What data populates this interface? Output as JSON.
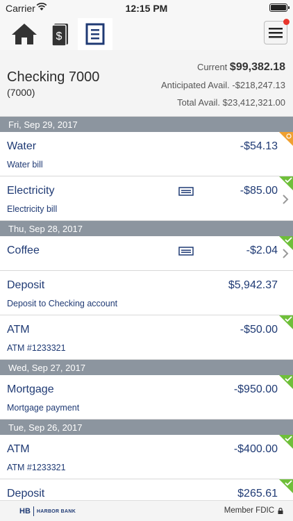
{
  "status": {
    "carrier": "Carrier",
    "time": "12:15 PM"
  },
  "nav": {
    "home_icon": "home-icon",
    "money_icon": "money-icon",
    "activity_icon": "activity-icon",
    "menu_icon": "menu-icon"
  },
  "account": {
    "name": "Checking 7000",
    "number": "(7000)",
    "current_label": "Current",
    "current_value": "$99,382.18",
    "anticipated": "Anticipated Avail. -$218,247.13",
    "total": "Total Avail. $23,412,321.00"
  },
  "groups": [
    {
      "date": "Fri, Sep 29, 2017",
      "transactions": [
        {
          "name": "Water",
          "desc": "Water bill",
          "amount": "-$54.13",
          "status": "pending"
        },
        {
          "name": "Electricity",
          "desc": "Electricity bill",
          "amount": "-$85.00",
          "status": "cleared",
          "card": true,
          "chevron": true
        }
      ]
    },
    {
      "date": "Thu, Sep 28, 2017",
      "transactions": [
        {
          "name": "Coffee",
          "desc": "",
          "amount": "-$2.04",
          "status": "cleared",
          "card": true,
          "chevron": true
        },
        {
          "name": "Deposit",
          "desc": "Deposit to Checking account",
          "amount": "$5,942.37",
          "status": "none"
        },
        {
          "name": "ATM",
          "desc": "ATM #1233321",
          "amount": "-$50.00",
          "status": "cleared"
        }
      ]
    },
    {
      "date": "Wed, Sep 27, 2017",
      "transactions": [
        {
          "name": "Mortgage",
          "desc": "Mortgage payment",
          "amount": "-$950.00",
          "status": "cleared"
        }
      ]
    },
    {
      "date": "Tue, Sep 26, 2017",
      "transactions": [
        {
          "name": "ATM",
          "desc": "ATM #1233321",
          "amount": "-$400.00",
          "status": "cleared"
        },
        {
          "name": "Deposit",
          "desc": "",
          "amount": "$265.61",
          "status": "cleared"
        }
      ]
    }
  ],
  "footer": {
    "logo_hb": "HB",
    "logo_name": "HARBOR BANK",
    "fdic": "Member FDIC"
  },
  "colors": {
    "accent": "#1f3a74",
    "cleared": "#6fbf3a",
    "pending": "#f0a030",
    "header": "#8c959f"
  }
}
